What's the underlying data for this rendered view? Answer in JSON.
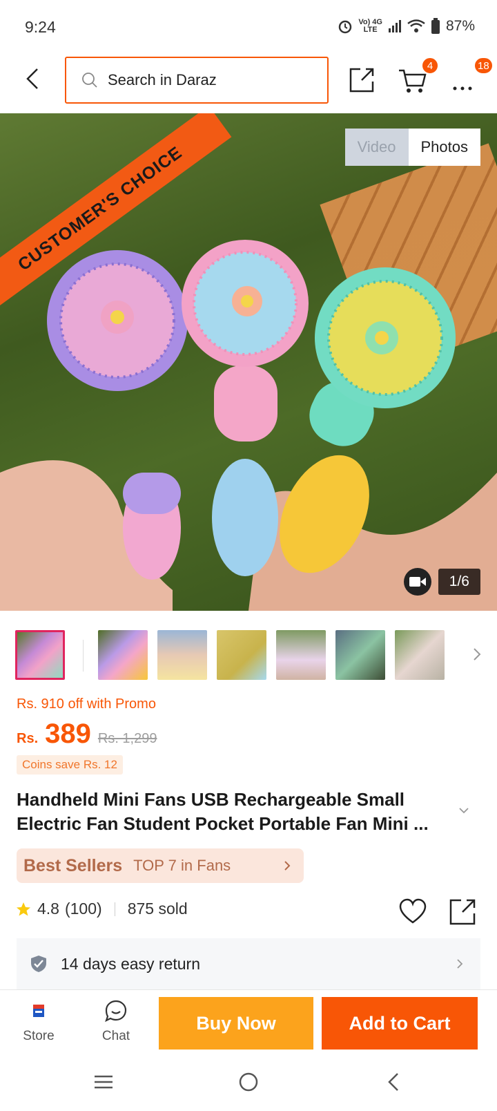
{
  "status_bar": {
    "time": "9:24",
    "network_top": "Vo) 4G",
    "network_bottom": "LTE",
    "battery": "87%"
  },
  "header": {
    "search_placeholder": "Search in Daraz",
    "cart_badge": "4",
    "more_badge": "18"
  },
  "hero": {
    "ribbon_text": "CUSTOMER'S CHOICE",
    "tab_video": "Video",
    "tab_photos": "Photos",
    "image_counter": "1/6"
  },
  "promo_text": "Rs. 910 off with Promo",
  "price": {
    "currency": "Rs.",
    "value": "389",
    "original": "Rs. 1,299"
  },
  "coins_text": "Coins save Rs. 12",
  "product_title": "Handheld Mini Fans USB Rechargeable Small Electric Fan Student Pocket Portable Fan Mini ...",
  "best_sellers": {
    "label": "Best Sellers",
    "rank": "TOP 7 in Fans"
  },
  "rating": {
    "score": "4.8",
    "count": "(100)",
    "sold": "875 sold"
  },
  "return_policy": "14 days easy return",
  "action_bar": {
    "store_label": "Store",
    "chat_label": "Chat",
    "buy_now": "Buy Now",
    "add_to_cart": "Add to Cart"
  },
  "colors": {
    "accent": "#f85606",
    "buy_now": "#fca31c"
  }
}
